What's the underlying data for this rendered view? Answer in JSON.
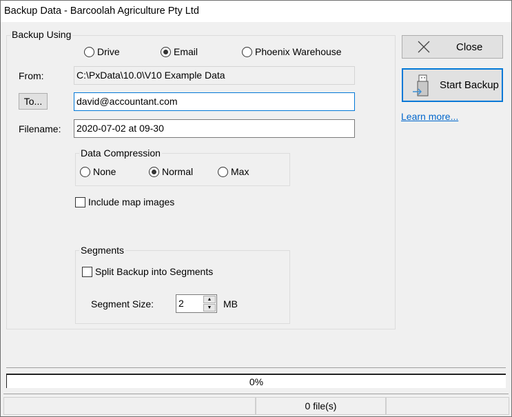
{
  "window": {
    "title": "Backup Data - Barcoolah Agriculture Pty Ltd"
  },
  "backup_using": {
    "legend": "Backup Using",
    "options": [
      {
        "label": "Drive",
        "checked": false
      },
      {
        "label": "Email",
        "checked": true
      },
      {
        "label": "Phoenix Warehouse",
        "checked": false
      }
    ]
  },
  "from": {
    "label": "From:",
    "value": "C:\\PxData\\10.0\\V10 Example Data"
  },
  "to": {
    "button_label": "To...",
    "value": "david@accountant.com"
  },
  "filename": {
    "label": "Filename:",
    "value": "2020-07-02 at 09-30"
  },
  "compression": {
    "legend": "Data Compression",
    "options": [
      {
        "label": "None",
        "checked": false
      },
      {
        "label": "Normal",
        "checked": true
      },
      {
        "label": "Max",
        "checked": false
      }
    ]
  },
  "include_map_images": {
    "label": "Include map images",
    "checked": false
  },
  "segments": {
    "legend": "Segments",
    "split_label": "Split Backup into Segments",
    "split_checked": false,
    "size_label": "Segment Size:",
    "size_value": "2",
    "size_unit": "MB"
  },
  "actions": {
    "close_label": "Close",
    "start_label": "Start Backup",
    "learn_more": "Learn more..."
  },
  "progress": {
    "percent": 0,
    "text": "0%"
  },
  "status_bar": {
    "cells": [
      "",
      "0 file(s)",
      ""
    ]
  }
}
